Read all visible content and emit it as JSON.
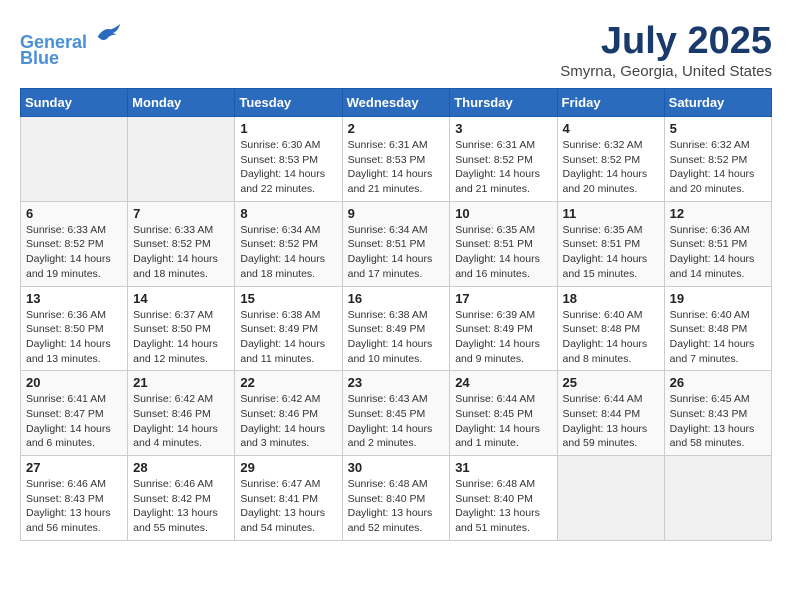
{
  "header": {
    "logo_line1": "General",
    "logo_line2": "Blue",
    "month": "July 2025",
    "location": "Smyrna, Georgia, United States"
  },
  "days_of_week": [
    "Sunday",
    "Monday",
    "Tuesday",
    "Wednesday",
    "Thursday",
    "Friday",
    "Saturday"
  ],
  "weeks": [
    [
      {
        "day": "",
        "detail": ""
      },
      {
        "day": "",
        "detail": ""
      },
      {
        "day": "1",
        "detail": "Sunrise: 6:30 AM\nSunset: 8:53 PM\nDaylight: 14 hours\nand 22 minutes."
      },
      {
        "day": "2",
        "detail": "Sunrise: 6:31 AM\nSunset: 8:53 PM\nDaylight: 14 hours\nand 21 minutes."
      },
      {
        "day": "3",
        "detail": "Sunrise: 6:31 AM\nSunset: 8:52 PM\nDaylight: 14 hours\nand 21 minutes."
      },
      {
        "day": "4",
        "detail": "Sunrise: 6:32 AM\nSunset: 8:52 PM\nDaylight: 14 hours\nand 20 minutes."
      },
      {
        "day": "5",
        "detail": "Sunrise: 6:32 AM\nSunset: 8:52 PM\nDaylight: 14 hours\nand 20 minutes."
      }
    ],
    [
      {
        "day": "6",
        "detail": "Sunrise: 6:33 AM\nSunset: 8:52 PM\nDaylight: 14 hours\nand 19 minutes."
      },
      {
        "day": "7",
        "detail": "Sunrise: 6:33 AM\nSunset: 8:52 PM\nDaylight: 14 hours\nand 18 minutes."
      },
      {
        "day": "8",
        "detail": "Sunrise: 6:34 AM\nSunset: 8:52 PM\nDaylight: 14 hours\nand 18 minutes."
      },
      {
        "day": "9",
        "detail": "Sunrise: 6:34 AM\nSunset: 8:51 PM\nDaylight: 14 hours\nand 17 minutes."
      },
      {
        "day": "10",
        "detail": "Sunrise: 6:35 AM\nSunset: 8:51 PM\nDaylight: 14 hours\nand 16 minutes."
      },
      {
        "day": "11",
        "detail": "Sunrise: 6:35 AM\nSunset: 8:51 PM\nDaylight: 14 hours\nand 15 minutes."
      },
      {
        "day": "12",
        "detail": "Sunrise: 6:36 AM\nSunset: 8:51 PM\nDaylight: 14 hours\nand 14 minutes."
      }
    ],
    [
      {
        "day": "13",
        "detail": "Sunrise: 6:36 AM\nSunset: 8:50 PM\nDaylight: 14 hours\nand 13 minutes."
      },
      {
        "day": "14",
        "detail": "Sunrise: 6:37 AM\nSunset: 8:50 PM\nDaylight: 14 hours\nand 12 minutes."
      },
      {
        "day": "15",
        "detail": "Sunrise: 6:38 AM\nSunset: 8:49 PM\nDaylight: 14 hours\nand 11 minutes."
      },
      {
        "day": "16",
        "detail": "Sunrise: 6:38 AM\nSunset: 8:49 PM\nDaylight: 14 hours\nand 10 minutes."
      },
      {
        "day": "17",
        "detail": "Sunrise: 6:39 AM\nSunset: 8:49 PM\nDaylight: 14 hours\nand 9 minutes."
      },
      {
        "day": "18",
        "detail": "Sunrise: 6:40 AM\nSunset: 8:48 PM\nDaylight: 14 hours\nand 8 minutes."
      },
      {
        "day": "19",
        "detail": "Sunrise: 6:40 AM\nSunset: 8:48 PM\nDaylight: 14 hours\nand 7 minutes."
      }
    ],
    [
      {
        "day": "20",
        "detail": "Sunrise: 6:41 AM\nSunset: 8:47 PM\nDaylight: 14 hours\nand 6 minutes."
      },
      {
        "day": "21",
        "detail": "Sunrise: 6:42 AM\nSunset: 8:46 PM\nDaylight: 14 hours\nand 4 minutes."
      },
      {
        "day": "22",
        "detail": "Sunrise: 6:42 AM\nSunset: 8:46 PM\nDaylight: 14 hours\nand 3 minutes."
      },
      {
        "day": "23",
        "detail": "Sunrise: 6:43 AM\nSunset: 8:45 PM\nDaylight: 14 hours\nand 2 minutes."
      },
      {
        "day": "24",
        "detail": "Sunrise: 6:44 AM\nSunset: 8:45 PM\nDaylight: 14 hours\nand 1 minute."
      },
      {
        "day": "25",
        "detail": "Sunrise: 6:44 AM\nSunset: 8:44 PM\nDaylight: 13 hours\nand 59 minutes."
      },
      {
        "day": "26",
        "detail": "Sunrise: 6:45 AM\nSunset: 8:43 PM\nDaylight: 13 hours\nand 58 minutes."
      }
    ],
    [
      {
        "day": "27",
        "detail": "Sunrise: 6:46 AM\nSunset: 8:43 PM\nDaylight: 13 hours\nand 56 minutes."
      },
      {
        "day": "28",
        "detail": "Sunrise: 6:46 AM\nSunset: 8:42 PM\nDaylight: 13 hours\nand 55 minutes."
      },
      {
        "day": "29",
        "detail": "Sunrise: 6:47 AM\nSunset: 8:41 PM\nDaylight: 13 hours\nand 54 minutes."
      },
      {
        "day": "30",
        "detail": "Sunrise: 6:48 AM\nSunset: 8:40 PM\nDaylight: 13 hours\nand 52 minutes."
      },
      {
        "day": "31",
        "detail": "Sunrise: 6:48 AM\nSunset: 8:40 PM\nDaylight: 13 hours\nand 51 minutes."
      },
      {
        "day": "",
        "detail": ""
      },
      {
        "day": "",
        "detail": ""
      }
    ]
  ]
}
